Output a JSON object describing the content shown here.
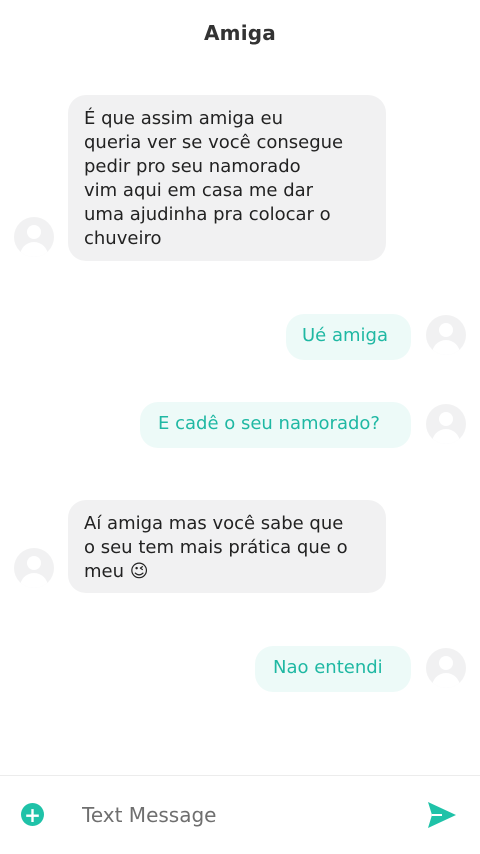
{
  "header": {
    "title": "Amiga"
  },
  "messages": [
    {
      "dir": "in",
      "text": "É que assim amiga eu\nqueria ver se você consegue\npedir pro seu namorado\nvim aqui em casa me dar\numa ajudinha pra colocar o\nchuveiro"
    },
    {
      "dir": "out",
      "text": "Ué amiga"
    },
    {
      "dir": "out",
      "text": "E cadê o seu namorado?"
    },
    {
      "dir": "in",
      "text": "Aí amiga mas você sabe que\no seu tem mais prática que o\nmeu 😉"
    },
    {
      "dir": "out",
      "text": "Nao entendi"
    }
  ],
  "composer": {
    "placeholder": "Text Message"
  },
  "colors": {
    "accent": "#1fc2a8",
    "outgoing_text": "#1fb8a3",
    "outgoing_bg": "#edfaf8",
    "incoming_bg": "#f1f1f2"
  },
  "icons": {
    "add": "plus-circle-icon",
    "send": "send-icon",
    "avatar": "user-avatar-icon"
  }
}
